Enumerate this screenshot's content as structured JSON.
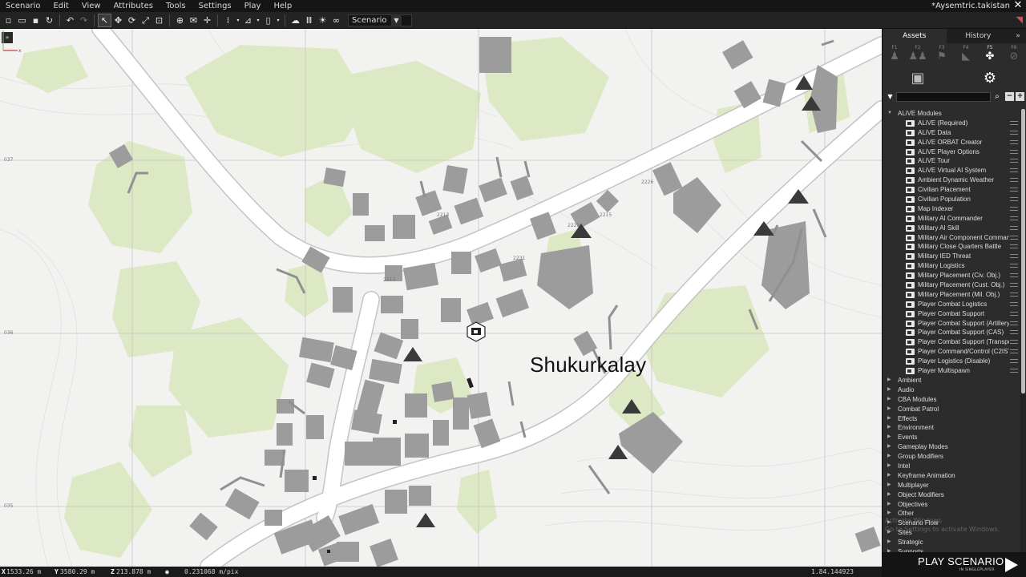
{
  "menu": {
    "items": [
      "Scenario",
      "Edit",
      "View",
      "Attributes",
      "Tools",
      "Settings",
      "Play",
      "Help"
    ],
    "window_title": "*Aysemtric.takistan",
    "close_glyph": "✕"
  },
  "toolbar": {
    "mode_value": "Scenario",
    "icons": [
      "new-file-icon",
      "open-folder-icon",
      "save-icon",
      "restart-icon",
      "undo-icon",
      "redo-icon",
      "select-tool-icon",
      "move-tool-icon",
      "rotate-tool-icon",
      "scale-tool-icon",
      "area-tool-icon",
      "map-toggle-icon",
      "snap-icon",
      "grid-icon",
      "vertical-snap-icon",
      "ruler-icon",
      "weather-icon",
      "lighting-icon",
      "vision-icon"
    ]
  },
  "map": {
    "place_name": "Shukurkalay",
    "grid_labels": [
      "037",
      "036",
      "035"
    ],
    "colors": {
      "background": "#f2f2f1",
      "vegetation": "#dde8c4",
      "building": "#9c9c9c",
      "road": "#ffffff",
      "road_edge": "#c8c8c8",
      "grid": "#c9c9c9"
    }
  },
  "status": {
    "x_label": "X",
    "x_value": "1533.26 m",
    "y_label": "Y",
    "y_value": "3580.29 m",
    "z_label": "Z",
    "z_value": "213.878 m",
    "scale_value": "0.231068 m/pix",
    "right_value": "1.84.144923"
  },
  "panel": {
    "tabs": [
      {
        "label": "Assets",
        "active": true
      },
      {
        "label": "History",
        "active": false
      }
    ],
    "expand_glyph": "»",
    "fkeys": [
      {
        "key": "F1",
        "icon": "soldier-icon"
      },
      {
        "key": "F2",
        "icon": "group-icon"
      },
      {
        "key": "F3",
        "icon": "flag-icon"
      },
      {
        "key": "F4",
        "icon": "marker-icon"
      },
      {
        "key": "F5",
        "icon": "modules-icon",
        "active": true
      },
      {
        "key": "F6",
        "icon": "unavailable-icon"
      }
    ],
    "search": {
      "placeholder": "",
      "value": ""
    },
    "tree": {
      "open_category": "ALiVE Modules",
      "modules": [
        "ALiVE (Required)",
        "ALiVE Data",
        "ALiVE ORBAT Creator",
        "ALiVE Player Options",
        "ALiVE Tour",
        "ALiVE Virtual AI System",
        "Ambient Dynamic Weather",
        "Civilian Placement",
        "Civilian Population",
        "Map Indexer",
        "Military AI Commander",
        "Military AI Skill",
        "Military Air Component Commander",
        "Military Close Quarters Battle",
        "Military IED Threat",
        "Military Logistics",
        "Military Placement (Civ. Obj.)",
        "Military Placement (Cust. Obj.)",
        "Military Placement (Mil. Obj.)",
        "Player Combat Logistics",
        "Player Combat Support",
        "Player Combat Support (Artillery)",
        "Player Combat Support (CAS)",
        "Player Combat Support (Transport)",
        "Player Command/Control (C2ISTAR)",
        "Player Logistics (Disable)",
        "Player Multispawn"
      ],
      "categories": [
        "Ambient",
        "Audio",
        "CBA Modules",
        "Combat Patrol",
        "Effects",
        "Environment",
        "Events",
        "Gameplay Modes",
        "Group Modifiers",
        "Intel",
        "Keyframe Animation",
        "Multiplayer",
        "Object Modifiers",
        "Objectives",
        "Other",
        "Scenario Flow",
        "Sites",
        "Strategic",
        "Supports"
      ]
    },
    "activate_line1": "Activate Windows",
    "activate_line2": "Go to Settings to activate Windows.",
    "play_title": "PLAY SCENARIO",
    "play_sub": "IN SINGLEPLAYER"
  }
}
